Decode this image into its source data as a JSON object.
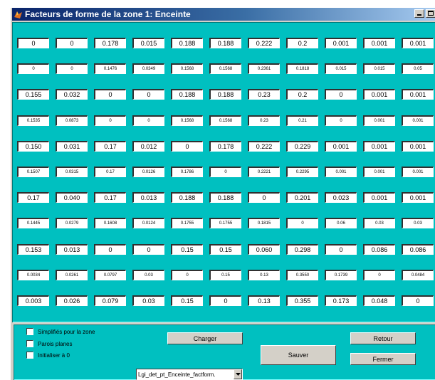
{
  "window": {
    "title": "Facteurs de forme de la zone 1: Enceinte",
    "title_bar_color": "#0a246a",
    "panel_color": "#00c0c0",
    "app_icon": "matlab-icon",
    "controls": [
      "minimize-icon",
      "maximize-icon"
    ]
  },
  "matrix": {
    "rows": [
      [
        "0",
        "0",
        "0.178",
        "0.015",
        "0.188",
        "0.188",
        "0.222",
        "0.2",
        "0.001",
        "0.001",
        "0.001"
      ],
      [
        "0",
        "0",
        "0.1476",
        "0.0349",
        "0.1568",
        "0.1568",
        "0.2361",
        "0.1818",
        "0.015",
        "0.015",
        "0.05"
      ],
      [
        "0.155",
        "0.032",
        "0",
        "0",
        "0.188",
        "0.188",
        "0.23",
        "0.2",
        "0",
        "0.001",
        "0.001"
      ],
      [
        "0.1535",
        "0.0873",
        "0",
        "0",
        "0.1568",
        "0.1568",
        "0.23",
        "0.21",
        "0",
        "0.001",
        "0.001"
      ],
      [
        "0.150",
        "0.031",
        "0.17",
        "0.012",
        "0",
        "0.178",
        "0.222",
        "0.229",
        "0.001",
        "0.001",
        "0.001"
      ],
      [
        "0.1507",
        "0.0315",
        "0.17",
        "0.0126",
        "0.1786",
        "0",
        "0.2221",
        "0.2295",
        "0.001",
        "0.001",
        "0.001"
      ],
      [
        "0.17",
        "0.040",
        "0.17",
        "0.013",
        "0.188",
        "0.188",
        "0",
        "0.201",
        "0.023",
        "0.001",
        "0.001"
      ],
      [
        "0.1445",
        "0.0279",
        "0.1608",
        "0.0124",
        "0.1755",
        "0.1755",
        "0.1815",
        "0",
        "0.06",
        "0.03",
        "0.03"
      ],
      [
        "0.153",
        "0.013",
        "0",
        "0",
        "0.15",
        "0.15",
        "0.060",
        "0.298",
        "0",
        "0.086",
        "0.086"
      ],
      [
        "0.0034",
        "0.0261",
        "0.0797",
        "0.03",
        "0",
        "0.15",
        "0.13",
        "0.3550",
        "0.1739",
        "0",
        "0.0484"
      ],
      [
        "0.003",
        "0.026",
        "0.079",
        "0.03",
        "0.15",
        "0",
        "0.13",
        "0.355",
        "0.173",
        "0.048",
        "0"
      ]
    ],
    "small_font_rows": [
      1,
      3,
      5,
      7,
      9
    ]
  },
  "controls": {
    "checkbox_simplified": {
      "label": "Simplifiés pour la zone",
      "checked": false
    },
    "checkbox_flat_walls": {
      "label": "Parois planes",
      "checked": false
    },
    "checkbox_init_zero": {
      "label": "Initialiser à 0",
      "checked": false
    },
    "load_button": "Charger",
    "save_button": "Sauver",
    "back_button": "Retour",
    "close_button": "Fermer",
    "file_select": {
      "value": "Lgi_det_pt_Enceinte_factform.",
      "icon": "chevron-down-icon"
    }
  }
}
